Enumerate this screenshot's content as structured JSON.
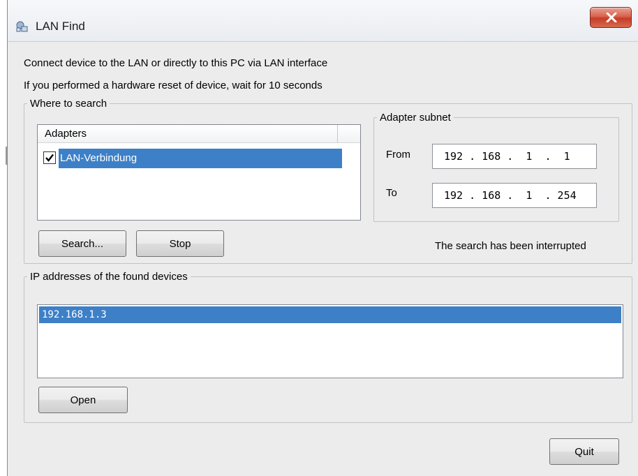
{
  "window": {
    "title": "LAN Find",
    "close_glyph": "X"
  },
  "intro": {
    "line1": "Connect device to the LAN or directly to this PC via LAN interface",
    "line2": "If you performed a hardware reset of device, wait for 10 seconds"
  },
  "where_to_search": {
    "legend": "Where to search",
    "adapters": {
      "header": "Adapters",
      "items": [
        {
          "label": "LAN-Verbindung",
          "checked": true,
          "selected": true
        }
      ]
    },
    "search_button": "Search...",
    "stop_button": "Stop",
    "status": "The search has been interrupted"
  },
  "adapter_subnet": {
    "legend": "Adapter subnet",
    "from_label": "From",
    "from_value": "192 . 168 .  1  .  1",
    "to_label": "To",
    "to_value": "192 . 168 .  1  . 254"
  },
  "found_devices": {
    "legend": "IP addresses of the found devices",
    "items": [
      "192.168.1.3"
    ],
    "open_button": "Open"
  },
  "quit_button": "Quit",
  "colors": {
    "selection": "#3d80c7",
    "window_bg": "#ececec",
    "close_button": "#c73d26"
  }
}
